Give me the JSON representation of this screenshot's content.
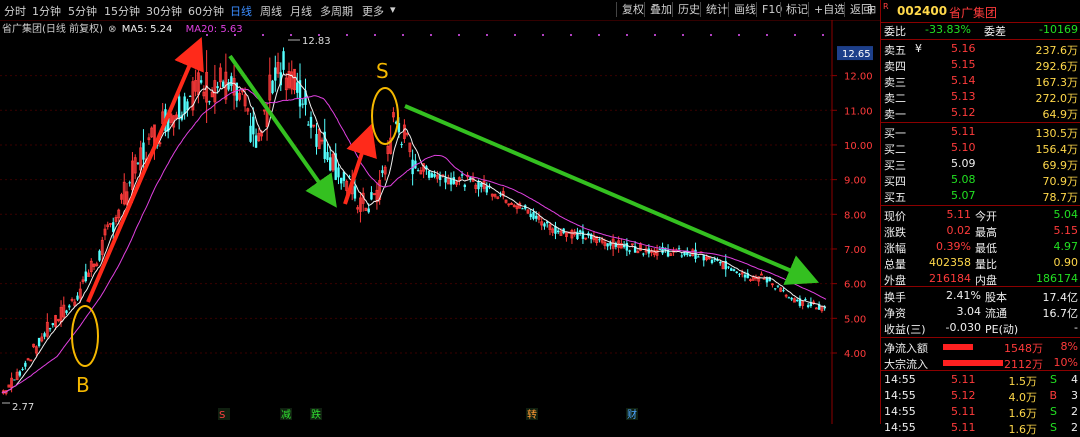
{
  "toolbar": {
    "periods": [
      "分时",
      "1分钟",
      "5分钟",
      "15分钟",
      "30分钟",
      "60分钟",
      "日线",
      "周线",
      "月线",
      "多周期",
      "更多"
    ],
    "active_period": "日线",
    "more_arrow": "▾",
    "right_buttons": [
      "复权",
      "叠加",
      "历史",
      "统计",
      "画线",
      "F10",
      "标记",
      "+自选",
      "返回"
    ]
  },
  "chart_info": {
    "stock_label": "省广集团(日线 前复权)",
    "ma5_label": "MA5: 5.24",
    "ma20_label": "MA20: 5.63"
  },
  "price_axis": {
    "current_marker": "12.65",
    "ticks": [
      "12.00",
      "11.00",
      "10.00",
      "9.00",
      "8.00",
      "7.00",
      "6.00",
      "5.00",
      "4.00"
    ]
  },
  "chart_data": {
    "type": "candlestick",
    "ylim": [
      2.5,
      13.2
    ],
    "high_label": "12.83",
    "low_label": "2.77",
    "ma_lines": [
      "MA5",
      "MA20"
    ],
    "annotations": {
      "buy_label": "B",
      "sell_label": "S"
    },
    "event_markers": [
      {
        "text": "S",
        "color": "#ff4040"
      },
      {
        "text": "减",
        "color": "#30e030"
      },
      {
        "text": "跌",
        "color": "#30e030"
      },
      {
        "text": "转",
        "color": "#ff9933"
      },
      {
        "text": "财",
        "color": "#4da6ff"
      }
    ]
  },
  "quote": {
    "code": "002400",
    "name": "省广集团",
    "r_badge": "R",
    "weibi_label": "委比",
    "weibi_value": "-33.83%",
    "weicha_label": "委差",
    "weicha_value": "-10169",
    "asks": [
      {
        "label": "卖五",
        "mark": "¥",
        "price": "5.16",
        "vol": "237.6万"
      },
      {
        "label": "卖四",
        "mark": "",
        "price": "5.15",
        "vol": "292.6万"
      },
      {
        "label": "卖三",
        "mark": "",
        "price": "5.14",
        "vol": "167.3万"
      },
      {
        "label": "卖二",
        "mark": "",
        "price": "5.13",
        "vol": "272.0万"
      },
      {
        "label": "卖一",
        "mark": "",
        "price": "5.12",
        "vol": "64.9万"
      }
    ],
    "bids": [
      {
        "label": "买一",
        "price": "5.11",
        "vol": "130.5万",
        "color": "red"
      },
      {
        "label": "买二",
        "price": "5.10",
        "vol": "156.4万",
        "color": "red"
      },
      {
        "label": "买三",
        "price": "5.09",
        "vol": "69.9万",
        "color": "white"
      },
      {
        "label": "买四",
        "price": "5.08",
        "vol": "70.9万",
        "color": "green"
      },
      {
        "label": "买五",
        "price": "5.07",
        "vol": "78.7万",
        "color": "green"
      }
    ],
    "stats": [
      {
        "l1": "现价",
        "v1": "5.11",
        "c1": "red",
        "l2": "今开",
        "v2": "5.04",
        "c2": "green"
      },
      {
        "l1": "涨跌",
        "v1": "0.02",
        "c1": "red",
        "l2": "最高",
        "v2": "5.15",
        "c2": "red"
      },
      {
        "l1": "涨幅",
        "v1": "0.39%",
        "c1": "red",
        "l2": "最低",
        "v2": "4.97",
        "c2": "green"
      },
      {
        "l1": "总量",
        "v1": "402358",
        "c1": "yellow",
        "l2": "量比",
        "v2": "0.90",
        "c2": "yellow"
      },
      {
        "l1": "外盘",
        "v1": "216184",
        "c1": "red",
        "l2": "内盘",
        "v2": "186174",
        "c2": "green"
      }
    ],
    "stats2": [
      {
        "l1": "换手",
        "v1": "2.41%",
        "l2": "股本",
        "v2": "17.4亿"
      },
      {
        "l1": "净资",
        "v1": "3.04",
        "l2": "流通",
        "v2": "16.7亿"
      },
      {
        "l1": "收益(三)",
        "v1": "-0.030",
        "l2": "PE(动)",
        "v2": "-"
      }
    ],
    "flows": [
      {
        "label": "净流入额",
        "value": "1548万",
        "pct": "8%"
      },
      {
        "label": "大宗流入",
        "value": "2112万",
        "pct": "10%"
      }
    ],
    "trades": [
      {
        "time": "14:55",
        "price": "5.11",
        "vol": "1.5万",
        "side": "S",
        "n": "4"
      },
      {
        "time": "14:55",
        "price": "5.12",
        "vol": "4.0万",
        "side": "B",
        "n": "3"
      },
      {
        "time": "14:55",
        "price": "5.11",
        "vol": "1.6万",
        "side": "S",
        "n": "2"
      },
      {
        "time": "14:55",
        "price": "5.11",
        "vol": "1.6万",
        "side": "S",
        "n": "2"
      }
    ]
  }
}
